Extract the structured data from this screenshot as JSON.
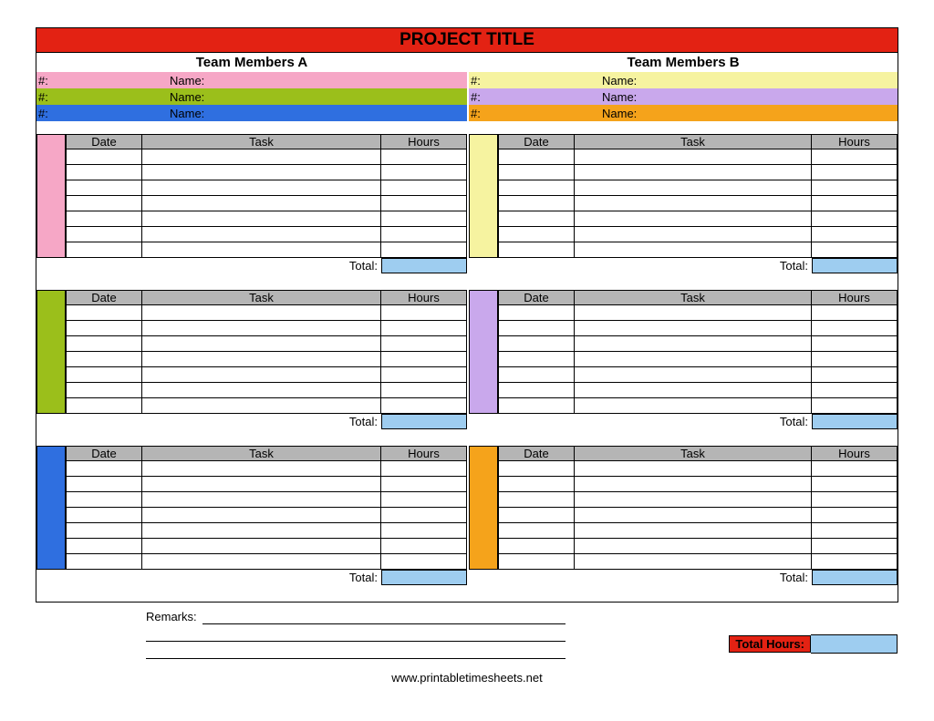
{
  "title": "PROJECT TITLE",
  "teamA": {
    "heading": "Team Members A",
    "members": [
      {
        "num_label": "#:",
        "name_label": "Name:",
        "color": "#f6a7c6"
      },
      {
        "num_label": "#:",
        "name_label": "Name:",
        "color": "#9bbf1b"
      },
      {
        "num_label": "#:",
        "name_label": "Name:",
        "color": "#2f6fe0"
      }
    ]
  },
  "teamB": {
    "heading": "Team Members B",
    "members": [
      {
        "num_label": "#:",
        "name_label": "Name:",
        "color": "#f6f3a0"
      },
      {
        "num_label": "#:",
        "name_label": "Name:",
        "color": "#c9a8ec"
      },
      {
        "num_label": "#:",
        "name_label": "Name:",
        "color": "#f5a31b"
      }
    ]
  },
  "columns": {
    "date": "Date",
    "task": "Task",
    "hours": "Hours"
  },
  "labels": {
    "total": "Total:",
    "remarks": "Remarks:",
    "total_hours": "Total Hours:"
  },
  "block_row_count": 7,
  "site": "www.printabletimesheets.net"
}
